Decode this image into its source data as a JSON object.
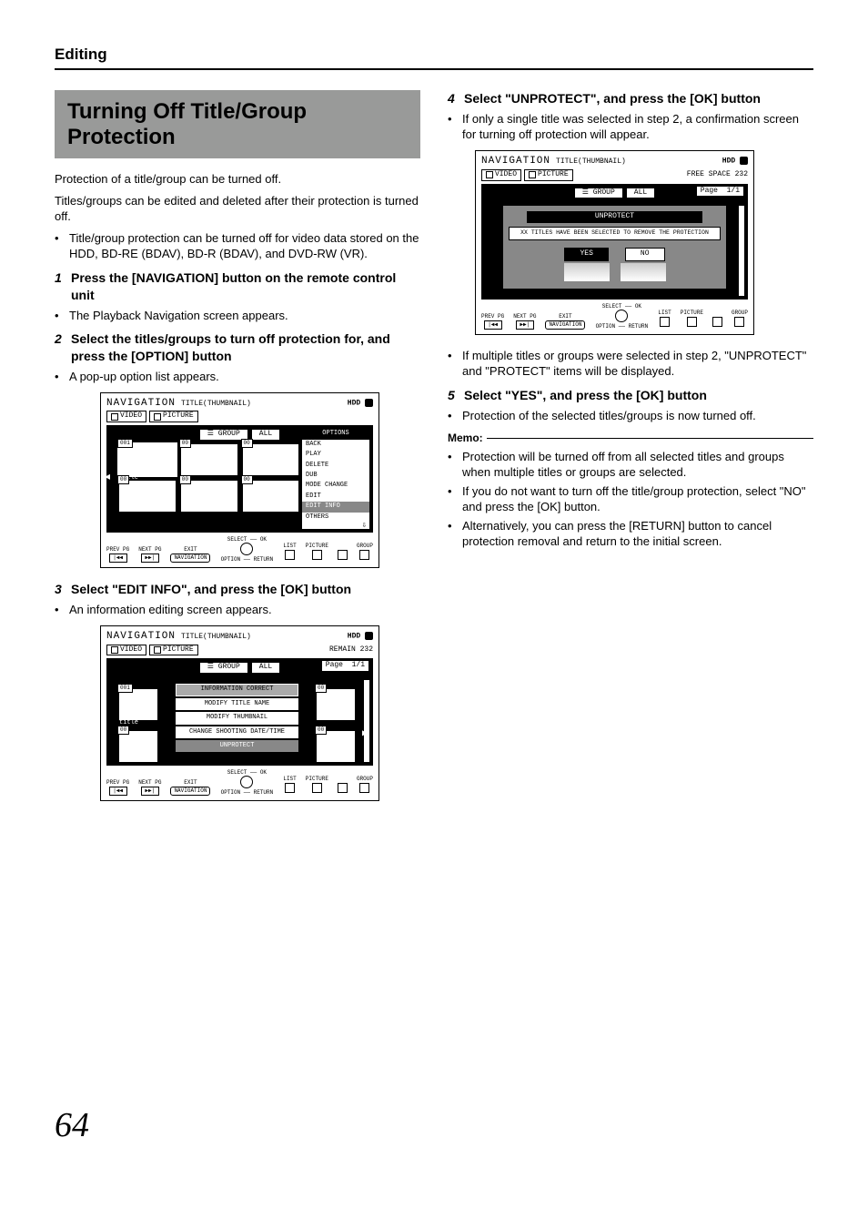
{
  "header": "Editing",
  "title": "Turning Off Title/Group Protection",
  "intro1": "Protection of a title/group can be turned off.",
  "intro2": "Titles/groups can be edited and deleted after their protection is turned off.",
  "bullet_intro": "Title/group protection can be turned off for video data stored on the HDD, BD-RE (BDAV), BD-R (BDAV), and DVD-RW (VR).",
  "steps": {
    "s1": {
      "num": "1",
      "txt": "Press the [NAVIGATION] button on the remote control unit"
    },
    "s1b": "The Playback Navigation screen appears.",
    "s2": {
      "num": "2",
      "txt": "Select the titles/groups to turn off protection for, and press the [OPTION] button"
    },
    "s2b": "A pop-up option list appears.",
    "s3": {
      "num": "3",
      "txt": "Select \"EDIT INFO\", and press the [OK] button"
    },
    "s3b": "An information editing screen appears.",
    "s4": {
      "num": "4",
      "txt": "Select \"UNPROTECT\", and press the [OK] button"
    },
    "s4b": "If only a single title was selected in step 2, a confirmation screen for turning off protection will appear.",
    "s4c": "If multiple titles or groups were selected in step 2, \"UNPROTECT\" and \"PROTECT\" items will be displayed.",
    "s5": {
      "num": "5",
      "txt": "Select \"YES\", and press the [OK] button"
    },
    "s5b": "Protection of the selected titles/groups is now turned off."
  },
  "memo": {
    "label": "Memo:",
    "m1": "Protection will be turned off from all selected titles and groups when multiple titles or groups are selected.",
    "m2": "If you do not want to turn off the title/group protection, select \"NO\" and press the [OK] button.",
    "m3": "Alternatively, you can press the [RETURN] button to cancel protection removal and return to the initial screen."
  },
  "screens": {
    "common": {
      "nav": "NAVIGATION",
      "sub": "TITLE(THUMBNAIL)",
      "hdd": "HDD",
      "video": "VIDEO",
      "picture": "PICTURE",
      "group": "GROUP",
      "all": "ALL",
      "page": "Page",
      "pg11": "1/1",
      "title_lbl": "title",
      "ft_prev": "PREV PG",
      "ft_next": "NEXT PG",
      "ft_exit": "EXIT",
      "ft_exit_btn": "NAVIGATION",
      "ft_select": "SELECT",
      "ft_ok": "OK",
      "ft_option": "OPTION",
      "ft_return": "RETURN",
      "ft_list": "LIST",
      "ft_pict": "PICTURE",
      "ft_group": "GROUP"
    },
    "s1": {
      "opts_head": "OPTIONS",
      "opts": [
        "BACK",
        "PLAY",
        "DELETE",
        "DUB",
        "MODE CHANGE",
        "EDIT",
        "EDIT INFO",
        "OTHERS"
      ]
    },
    "s2": {
      "remain": "REMAIN 232",
      "info_head": "INFORMATION CORRECT",
      "items": [
        "MODIFY TITLE NAME",
        "MODIFY THUMBNAIL",
        "CHANGE SHOOTING DATE/TIME",
        "UNPROTECT"
      ]
    },
    "s3": {
      "free": "FREE SPACE 232",
      "dlg_title": "UNPROTECT",
      "dlg_msg": "XX TITLES HAVE BEEN SELECTED TO REMOVE THE PROTECTION",
      "yes": "YES",
      "no": "NO"
    }
  },
  "page_number": "64"
}
